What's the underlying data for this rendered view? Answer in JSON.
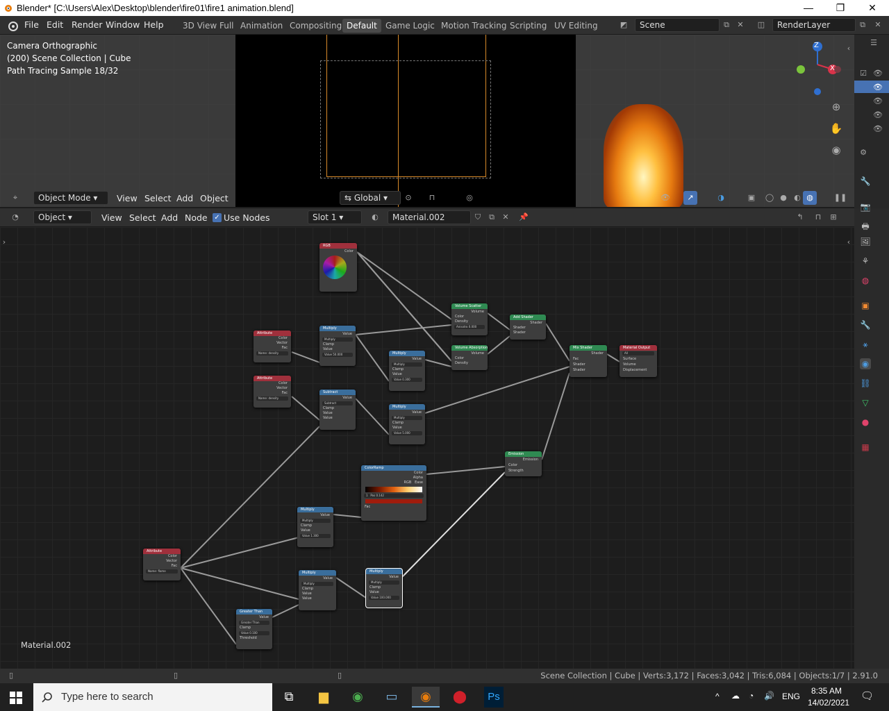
{
  "window": {
    "title": "Blender* [C:\\Users\\Alex\\Desktop\\blender\\fire01\\fire1 animation.blend]",
    "min": "—",
    "max": "❐",
    "close": "✕"
  },
  "menus": [
    "File",
    "Edit",
    "Render",
    "Window",
    "Help"
  ],
  "workspaces": [
    "3D View Full",
    "Animation",
    "Compositing",
    "Default",
    "Game Logic",
    "Motion Tracking",
    "Scripting",
    "UV Editing"
  ],
  "scene": {
    "name": "Scene",
    "view_layer": "RenderLayer"
  },
  "viewport": {
    "overlay": [
      "Camera Orthographic",
      "(200) Scene Collection | Cube",
      "Path Tracing Sample 18/32"
    ],
    "mode": "Object Mode",
    "menus": [
      "View",
      "Select",
      "Add",
      "Object"
    ],
    "orientation": "Global",
    "gizmo": {
      "z": "Z",
      "x": "X"
    }
  },
  "node_editor": {
    "type": "Object",
    "menus": [
      "View",
      "Select",
      "Add",
      "Node"
    ],
    "use_nodes_label": "Use Nodes",
    "slot": "Slot 1",
    "material": "Material.002",
    "footer_label": "Material.002"
  },
  "nodes": {
    "rgb": {
      "title": "RGB",
      "out": "Color"
    },
    "attr1": {
      "title": "Attribute",
      "outs": [
        "Color",
        "Vector",
        "Fac"
      ],
      "name_label": "Name:",
      "name": "density"
    },
    "attr2": {
      "title": "Attribute",
      "outs": [
        "Color",
        "Vector",
        "Fac"
      ],
      "name_label": "Name:",
      "name": "density"
    },
    "attr3": {
      "title": "Attribute",
      "outs": [
        "Color",
        "Vector",
        "Fac"
      ],
      "name_label": "Name:",
      "name": "flame"
    },
    "mult1": {
      "title": "Multiply",
      "out": "Value",
      "op": "Multiply",
      "clamp": "Clamp",
      "in": "Value",
      "val": "Value   50.000"
    },
    "mult2": {
      "title": "Multiply",
      "out": "Value",
      "op": "Multiply",
      "clamp": "Clamp",
      "in": "Value",
      "val": "Value   0.300"
    },
    "mult3": {
      "title": "Multiply",
      "out": "Value",
      "op": "Multiply",
      "clamp": "Clamp",
      "in": "Value",
      "val": "Value   5.000"
    },
    "mult4": {
      "title": "Multiply",
      "out": "Value",
      "op": "Multiply",
      "clamp": "Clamp",
      "in": "Value",
      "val": "Value   1.300"
    },
    "mult5": {
      "title": "Multiply",
      "out": "Value",
      "op": "Multiply",
      "clamp": "Clamp",
      "in1": "Value",
      "in2": "Value"
    },
    "mult6": {
      "title": "Multiply",
      "out": "Value",
      "op": "Multiply",
      "clamp": "Clamp",
      "in": "Value",
      "val": "Value   100.000"
    },
    "subtract": {
      "title": "Subtract",
      "out": "Value",
      "op": "Subtract",
      "clamp": "Clamp",
      "in1": "Value",
      "in2": "Value"
    },
    "greater": {
      "title": "Greater Than",
      "out": "Value",
      "op": "Greater Than",
      "clamp": "Clamp",
      "val": "Value   0.100",
      "in": "Threshold"
    },
    "vscatter": {
      "title": "Volume Scatter",
      "out": "Volume",
      "ins": [
        "Color",
        "Density"
      ],
      "val": "Anisotro 0.000"
    },
    "vabsorb": {
      "title": "Volume Absorption",
      "out": "Volume",
      "ins": [
        "Color",
        "Density"
      ]
    },
    "addshader": {
      "title": "Add Shader",
      "out": "Shader",
      "ins": [
        "Shader",
        "Shader"
      ]
    },
    "mixshader": {
      "title": "Mix Shader",
      "out": "Shader",
      "ins": [
        "Fac",
        "Shader",
        "Shader"
      ]
    },
    "matout": {
      "title": "Material Output",
      "sel": "All",
      "ins": [
        "Surface",
        "Volume",
        "Displacement"
      ]
    },
    "emission": {
      "title": "Emission",
      "out": "Emission",
      "ins": [
        "Color",
        "Strength"
      ]
    },
    "colorramp": {
      "title": "ColorRamp",
      "outs": [
        "Color",
        "Alpha"
      ],
      "mode": "RGB",
      "interp": "Ease",
      "idx": "1",
      "pos": "Pos",
      "posval": "0.142",
      "in": "Fac"
    }
  },
  "status": "Scene Collection | Cube | Verts:3,172 | Faces:3,042 | Tris:6,084 | Objects:1/7 | 2.91.0",
  "taskbar": {
    "search_placeholder": "Type here to search",
    "lang": "ENG",
    "time": "8:35 AM",
    "date": "14/02/2021"
  },
  "colors": {
    "accent": "#4772b3",
    "attribute_header": "#a0303c",
    "converter_header": "#3a6e9c",
    "shader_header": "#2f8a52"
  }
}
